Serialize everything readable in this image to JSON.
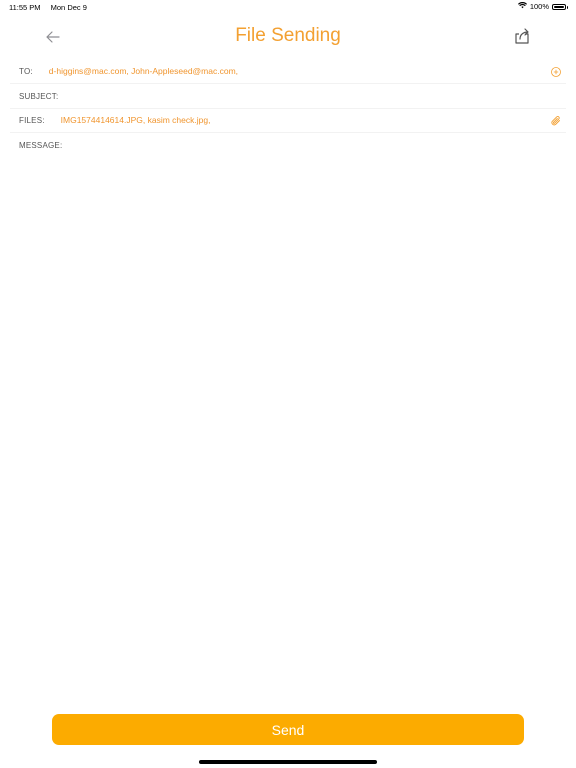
{
  "status_bar": {
    "time": "11:55 PM",
    "date": "Mon Dec 9",
    "battery": "100%"
  },
  "nav": {
    "title": "File Sending"
  },
  "form": {
    "to_label": "TO:",
    "to_value": "d-higgins@mac.com, John-Appleseed@mac.com,",
    "subject_label": "SUBJECT:",
    "subject_value": "",
    "files_label": "FILES:",
    "files_value": "IMG1574414614.JPG, kasim check.jpg,",
    "message_label": "MESSAGE:",
    "message_value": ""
  },
  "actions": {
    "send_label": "Send"
  },
  "colors": {
    "accent": "#f3a031",
    "button": "#fcab00"
  },
  "icons": {
    "back": "arrow-left-icon",
    "share": "share-icon",
    "add_recipient": "plus-circle-icon",
    "attach": "paperclip-icon",
    "wifi": "wifi-icon",
    "battery": "battery-icon"
  }
}
